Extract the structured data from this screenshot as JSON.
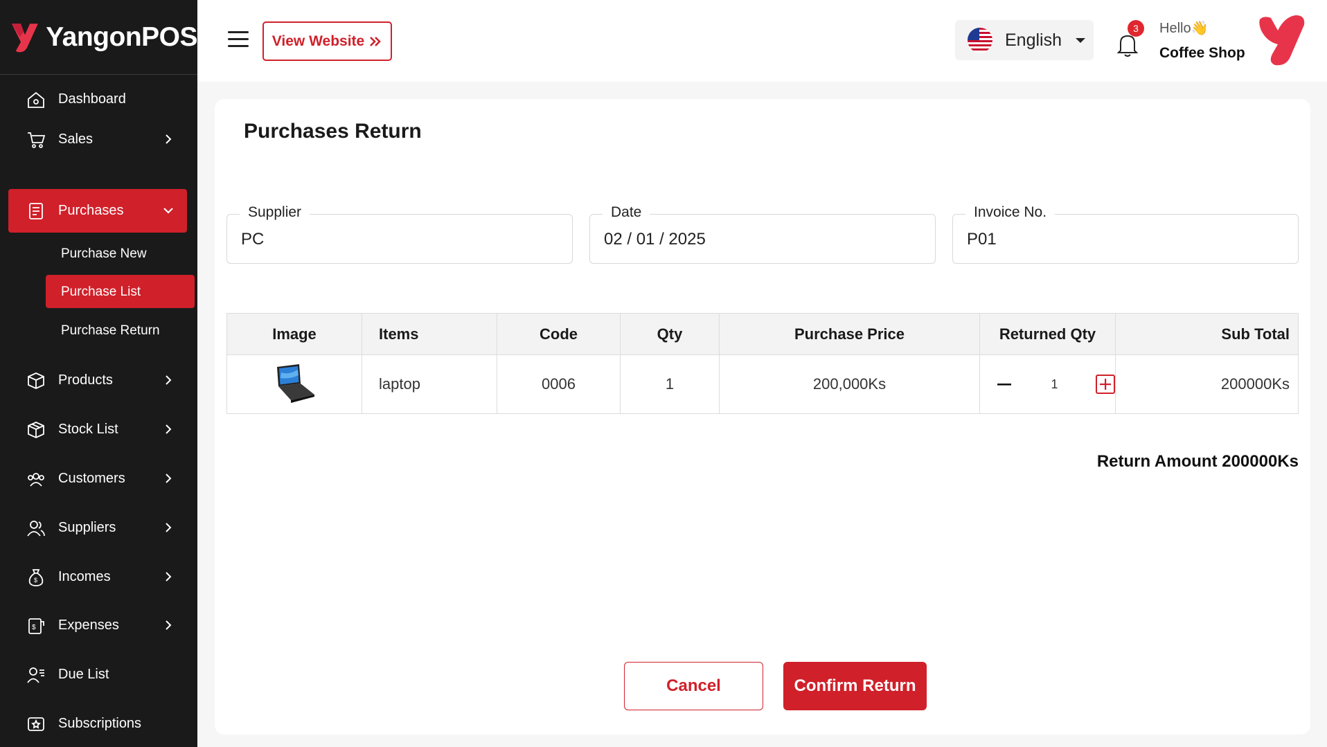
{
  "brand": {
    "name": "YangonPOS"
  },
  "sidebar": {
    "items": [
      {
        "label": "Dashboard",
        "icon": "home-icon"
      },
      {
        "label": "Sales",
        "icon": "cart-icon"
      },
      {
        "label": "Purchases",
        "icon": "receipt-icon"
      },
      {
        "label": "Products",
        "icon": "box-icon"
      },
      {
        "label": "Stock List",
        "icon": "package-icon"
      },
      {
        "label": "Customers",
        "icon": "users-icon"
      },
      {
        "label": "Suppliers",
        "icon": "supplier-icon"
      },
      {
        "label": "Incomes",
        "icon": "money-bag-icon"
      },
      {
        "label": "Expenses",
        "icon": "expense-receipt-icon"
      },
      {
        "label": "Due List",
        "icon": "user-list-icon"
      },
      {
        "label": "Subscriptions",
        "icon": "subscription-icon"
      }
    ],
    "purchases_sub": [
      {
        "label": "Purchase New"
      },
      {
        "label": "Purchase List"
      },
      {
        "label": "Purchase Return"
      }
    ]
  },
  "header": {
    "view_website": "View Website",
    "language": "English",
    "notification_count": "3",
    "greeting": "Hello👋",
    "shop_name": "Coffee Shop"
  },
  "page": {
    "title": "Purchases Return",
    "fields": {
      "supplier_label": "Supplier",
      "supplier_value": "PC",
      "date_label": "Date",
      "date_value": "02 / 01 / 2025",
      "invoice_label": "Invoice No.",
      "invoice_value": "P01"
    },
    "table": {
      "headers": [
        "Image",
        "Items",
        "Code",
        "Qty",
        "Purchase Price",
        "Returned Qty",
        "Sub Total"
      ],
      "rows": [
        {
          "image": "laptop-image",
          "item": "laptop",
          "code": "0006",
          "qty": "1",
          "price": "200,000Ks",
          "returned_qty": "1",
          "subtotal": "200000Ks"
        }
      ]
    },
    "return_amount": "Return Amount 200000Ks",
    "cancel_label": "Cancel",
    "confirm_label": "Confirm Return"
  },
  "colors": {
    "accent": "#d0202a",
    "sidebar_bg": "#1a1a1a"
  }
}
